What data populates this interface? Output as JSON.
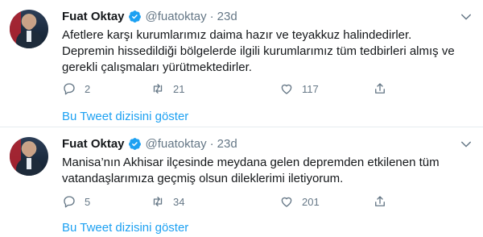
{
  "tweets": [
    {
      "author_name": "Fuat Oktay",
      "handle": "@fuatoktay",
      "time": "23d",
      "text": "Afetlere karşı kurumlarımız daima hazır ve teyakkuz halindedirler. Depremin hissedildiği bölgelerde ilgili kurumlarımız tüm tedbirleri almış ve gerekli çalışmaları yürütmektedirler.",
      "replies": "2",
      "retweets": "21",
      "likes": "117",
      "show_thread": "Bu Tweet dizisini göster"
    },
    {
      "author_name": "Fuat Oktay",
      "handle": "@fuatoktay",
      "time": "23d",
      "text": "Manisa’nın Akhisar ilçesinde meydana gelen depremden etkilenen tüm vatandaşlarımıza geçmiş olsun dileklerimi iletiyorum.",
      "replies": "5",
      "retweets": "34",
      "likes": "201",
      "show_thread": "Bu Tweet dizisini göster"
    }
  ],
  "colors": {
    "accent": "#1da1f2",
    "muted": "#657786",
    "text": "#14171a",
    "divider": "#e6ecf0"
  },
  "icons": [
    "verified-badge-icon",
    "chevron-down-icon",
    "reply-icon",
    "retweet-icon",
    "like-icon",
    "share-icon"
  ]
}
